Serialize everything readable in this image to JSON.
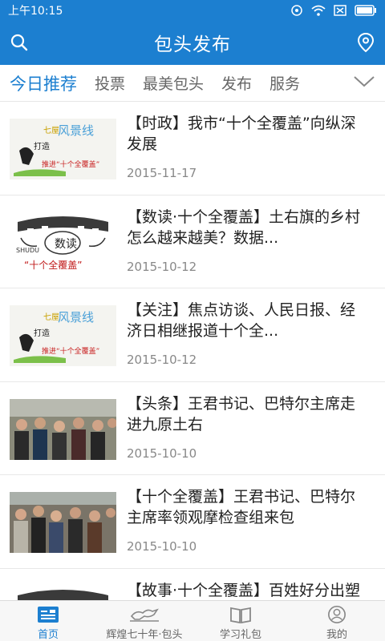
{
  "status_bar": {
    "time": "上午10:15"
  },
  "header": {
    "title": "包头发布"
  },
  "tabs": [
    {
      "label": "今日推荐"
    },
    {
      "label": "投票"
    },
    {
      "label": "最美包头"
    },
    {
      "label": "发布"
    },
    {
      "label": "服务"
    }
  ],
  "news": [
    {
      "title": "【时政】我市“十个全覆盖”向纵深发展",
      "date": "2015-11-17",
      "thumb_text": "推进“十个全覆盖”"
    },
    {
      "title": "【数读·十个全覆盖】土右旗的乡村怎么越来越美？数据...",
      "date": "2015-10-12",
      "thumb_text": "“十个全覆盖”"
    },
    {
      "title": "【关注】焦点访谈、人民日报、经济日相继报道十个全...",
      "date": "2015-10-12",
      "thumb_text": "推进“十个全覆盖”"
    },
    {
      "title": "【头条】王君书记、巴特尔主席走进九原土右",
      "date": "2015-10-10"
    },
    {
      "title": "【十个全覆盖】王君书记、巴特尔主席率领观摩检查组来包",
      "date": "2015-10-10"
    },
    {
      "title": "【故事·十个全覆盖】百姓好分出塑云旺：田先金送行孟...",
      "date": ""
    }
  ],
  "tabbar": [
    {
      "label": "首页"
    },
    {
      "label": "辉煌七十年·包头"
    },
    {
      "label": "学习礼包"
    },
    {
      "label": "我的"
    }
  ],
  "colors": {
    "brand": "#1c7fd0"
  }
}
